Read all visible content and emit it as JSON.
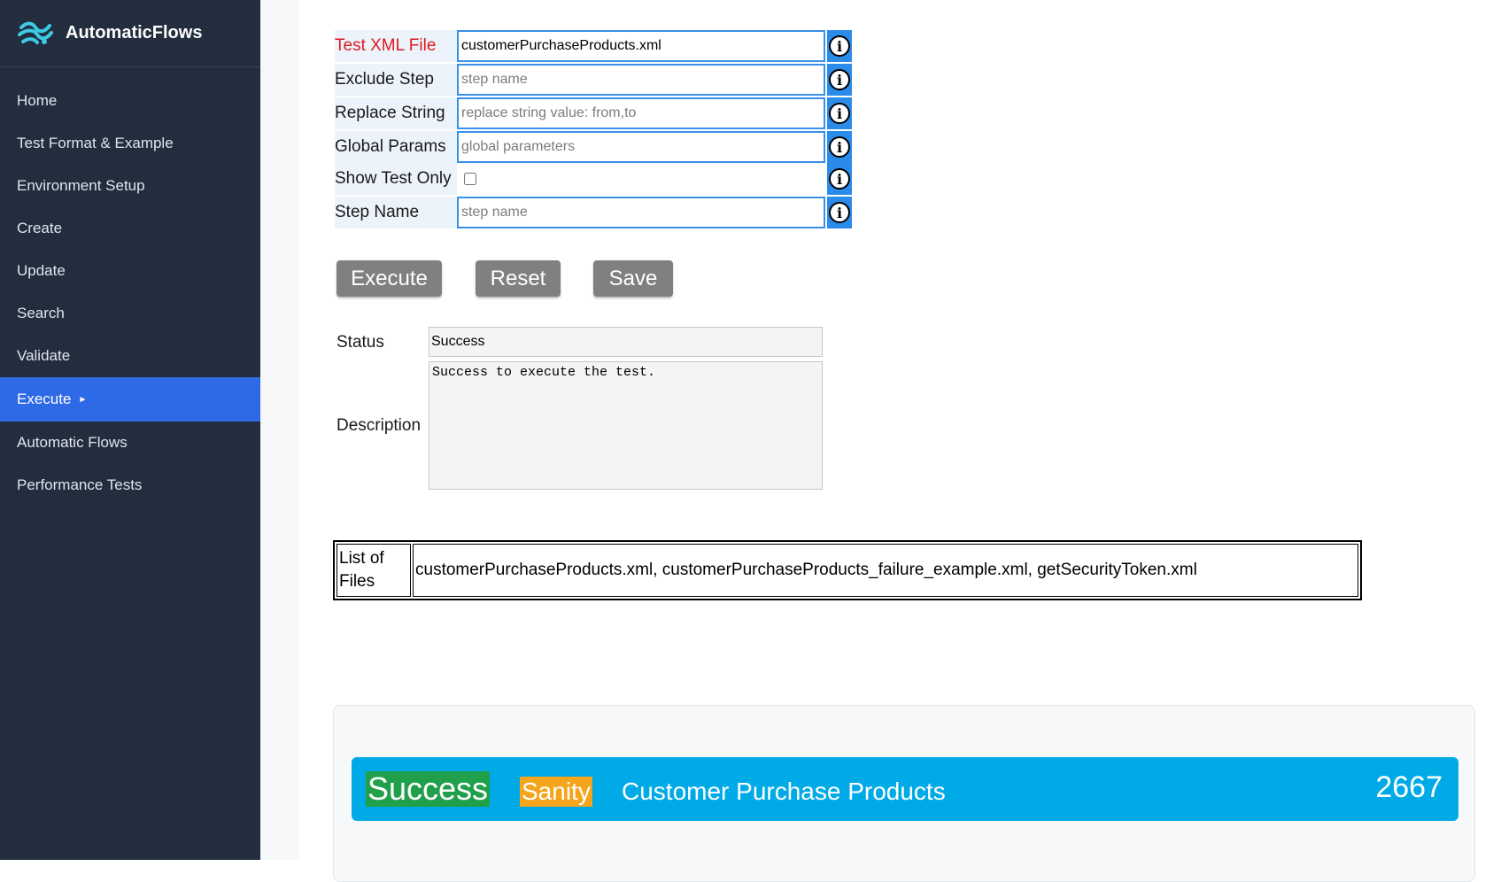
{
  "app": {
    "name": "AutomaticFlows"
  },
  "sidebar": {
    "items": [
      {
        "label": "Home"
      },
      {
        "label": "Test Format & Example"
      },
      {
        "label": "Environment Setup"
      },
      {
        "label": "Create"
      },
      {
        "label": "Update"
      },
      {
        "label": "Search"
      },
      {
        "label": "Validate"
      },
      {
        "label": "Execute",
        "active": true
      },
      {
        "label": "Automatic Flows"
      },
      {
        "label": "Performance Tests"
      }
    ],
    "active_color": "#2f6ae6"
  },
  "form": {
    "test_xml_file": {
      "label": "Test XML File",
      "value": "customerPurchaseProducts.xml"
    },
    "exclude_step": {
      "label": "Exclude Step",
      "placeholder": "step name"
    },
    "replace_string": {
      "label": "Replace String",
      "placeholder": "replace string value: from,to"
    },
    "global_params": {
      "label": "Global Params",
      "placeholder": "global parameters"
    },
    "show_test_only": {
      "label": "Show Test Only",
      "checked": false
    },
    "step_name": {
      "label": "Step Name",
      "placeholder": "step name"
    },
    "info_icon": "info-icon"
  },
  "buttons": {
    "execute": "Execute",
    "reset": "Reset",
    "save": "Save"
  },
  "result": {
    "status_label": "Status",
    "status_value": "Success",
    "description_label": "Description",
    "description_value": "Success to execute the test."
  },
  "files": {
    "header": "List of Files",
    "value": "customerPurchaseProducts.xml, customerPurchaseProducts_failure_example.xml, getSecurityToken.xml"
  },
  "summary": {
    "status": "Success",
    "tag": "Sanity",
    "title": "Customer Purchase Products",
    "count": "2667",
    "colors": {
      "banner": "#00aae6",
      "success": "#21a04c",
      "sanity": "#f4a51c"
    }
  }
}
